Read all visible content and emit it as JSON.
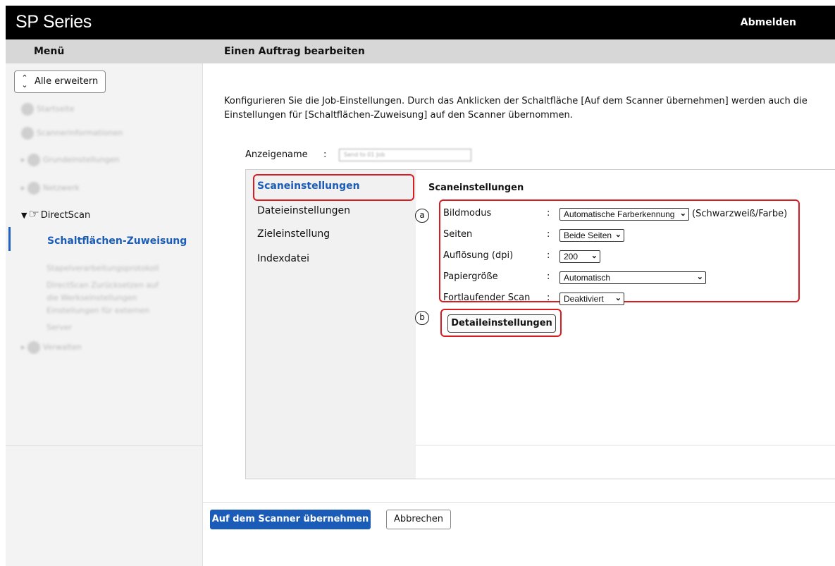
{
  "header": {
    "brand": "SP Series",
    "logout": "Abmelden"
  },
  "subbar": {
    "menu_title": "Menü",
    "page_title": "Einen Auftrag bearbeiten"
  },
  "sidebar": {
    "expand_all": "Alle erweitern",
    "items": {
      "home": "Startseite",
      "scanner_info": "Scannerinformationen",
      "basic_settings": "Grundeinstellungen",
      "network": "Netzwerk",
      "directscan": "DirectScan",
      "button_assignment": "Schaltflächen-Zuweisung",
      "batch_log": "Stapelverarbeitungsprotokoll",
      "reset_1": "DirectScan Zurücksetzen auf",
      "reset_2": "die Werkseinstellungen",
      "external_server_1": "Einstellungen für externen",
      "external_server_2": "Server",
      "manage": "Verwalten"
    }
  },
  "main": {
    "intro_line1": "Konfigurieren Sie die Job-Einstellungen. Durch das Anklicken der Schaltfläche [Auf dem Scanner übernehmen] werden auch die",
    "intro_line2": "Einstellungen für [Schaltflächen-Zuweisung] auf den Scanner übernommen.",
    "display_name_label": "Anzeigename",
    "display_name_colon": ":",
    "display_name_value": "Send to 01 Job",
    "tabs": [
      "Scaneinstellungen",
      "Dateieinstellungen",
      "Zieleinstellung",
      "Indexdatei"
    ],
    "section_title": "Scaneinstellungen",
    "settings": [
      {
        "label": "Bildmodus",
        "value": "Automatische Farberkennung",
        "hint": "(Schwarzweiß/Farbe)"
      },
      {
        "label": "Seiten",
        "value": "Beide Seiten"
      },
      {
        "label": "Auflösung (dpi)",
        "value": "200"
      },
      {
        "label": "Papiergröße",
        "value": "Automatisch"
      },
      {
        "label": "Fortlaufender Scan",
        "value": "Deaktiviert"
      }
    ],
    "colon": ":",
    "marker_a": "a",
    "marker_b": "b",
    "detail_button": "Detaileinstellungen",
    "apply_button": "Auf dem Scanner übernehmen",
    "cancel_button": "Abbrechen"
  },
  "colors": {
    "accent": "#1a5cb8",
    "highlight": "#d81c22",
    "header_bg": "#000000"
  }
}
